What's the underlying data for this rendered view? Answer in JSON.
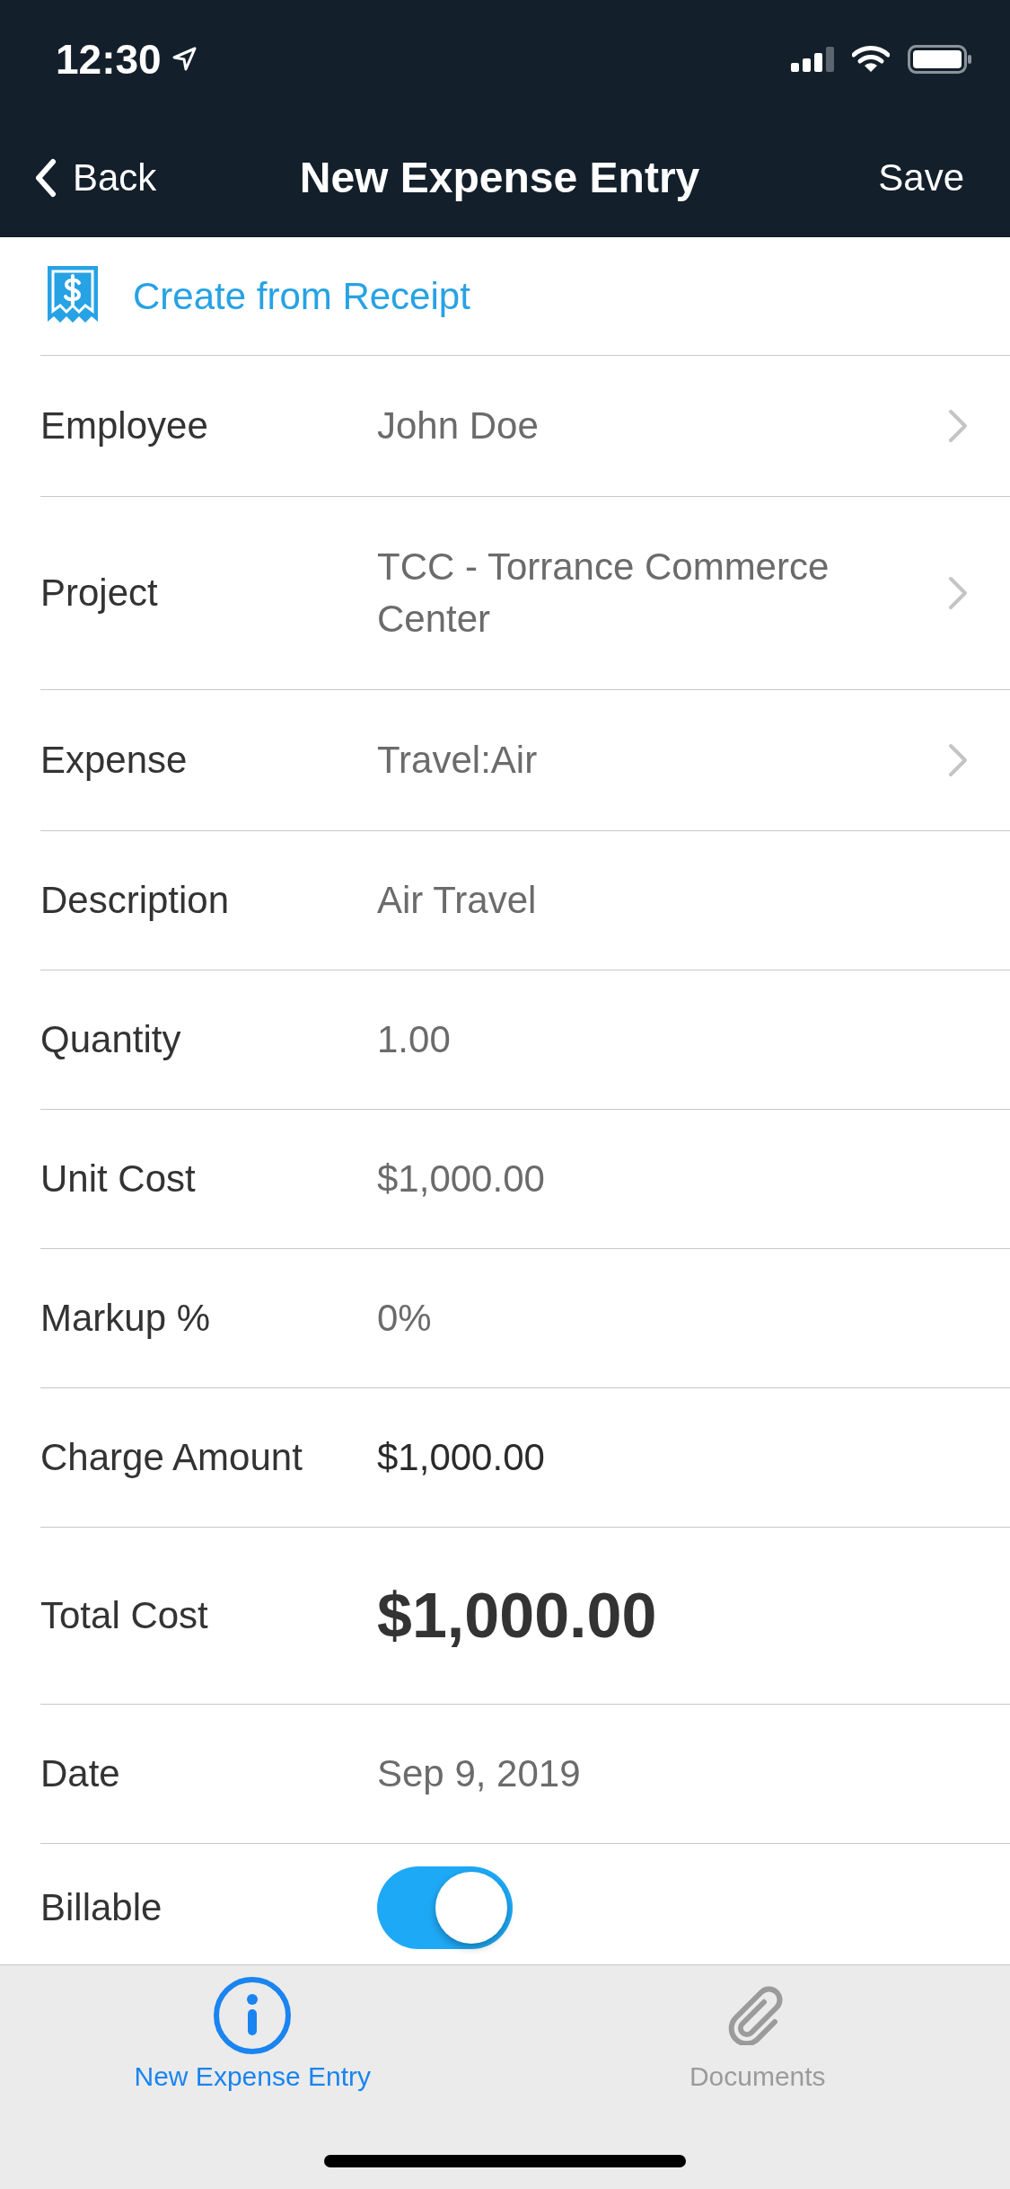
{
  "status_bar": {
    "time": "12:30"
  },
  "nav_bar": {
    "back": "Back",
    "title": "New Expense Entry",
    "action": "Save"
  },
  "receipt_link": {
    "label": "Create from Receipt"
  },
  "rows": [
    {
      "kind": "picker",
      "label": "Employee",
      "value": "John Doe"
    },
    {
      "kind": "picker",
      "label": "Project",
      "value": "TCC - Torrance Commerce Center"
    },
    {
      "kind": "picker",
      "label": "Expense",
      "value": "Travel:Air"
    },
    {
      "kind": "input",
      "label": "Description",
      "value": "Air Travel"
    },
    {
      "kind": "input",
      "label": "Quantity",
      "value": "1.00"
    },
    {
      "kind": "input",
      "label": "Unit Cost",
      "value": "$1,000.00"
    },
    {
      "kind": "input",
      "label": "Markup %",
      "value": "0%"
    },
    {
      "kind": "readonly",
      "label": "Charge Amount",
      "value": "$1,000.00"
    },
    {
      "kind": "total",
      "label": "Total Cost",
      "value": "$1,000.00"
    },
    {
      "kind": "input",
      "label": "Date",
      "value": "Sep 9, 2019"
    },
    {
      "kind": "toggle",
      "label": "Billable",
      "on": true
    }
  ],
  "tabs": [
    {
      "label": "New Expense Entry",
      "selected": true
    },
    {
      "label": "Documents",
      "selected": false
    }
  ]
}
